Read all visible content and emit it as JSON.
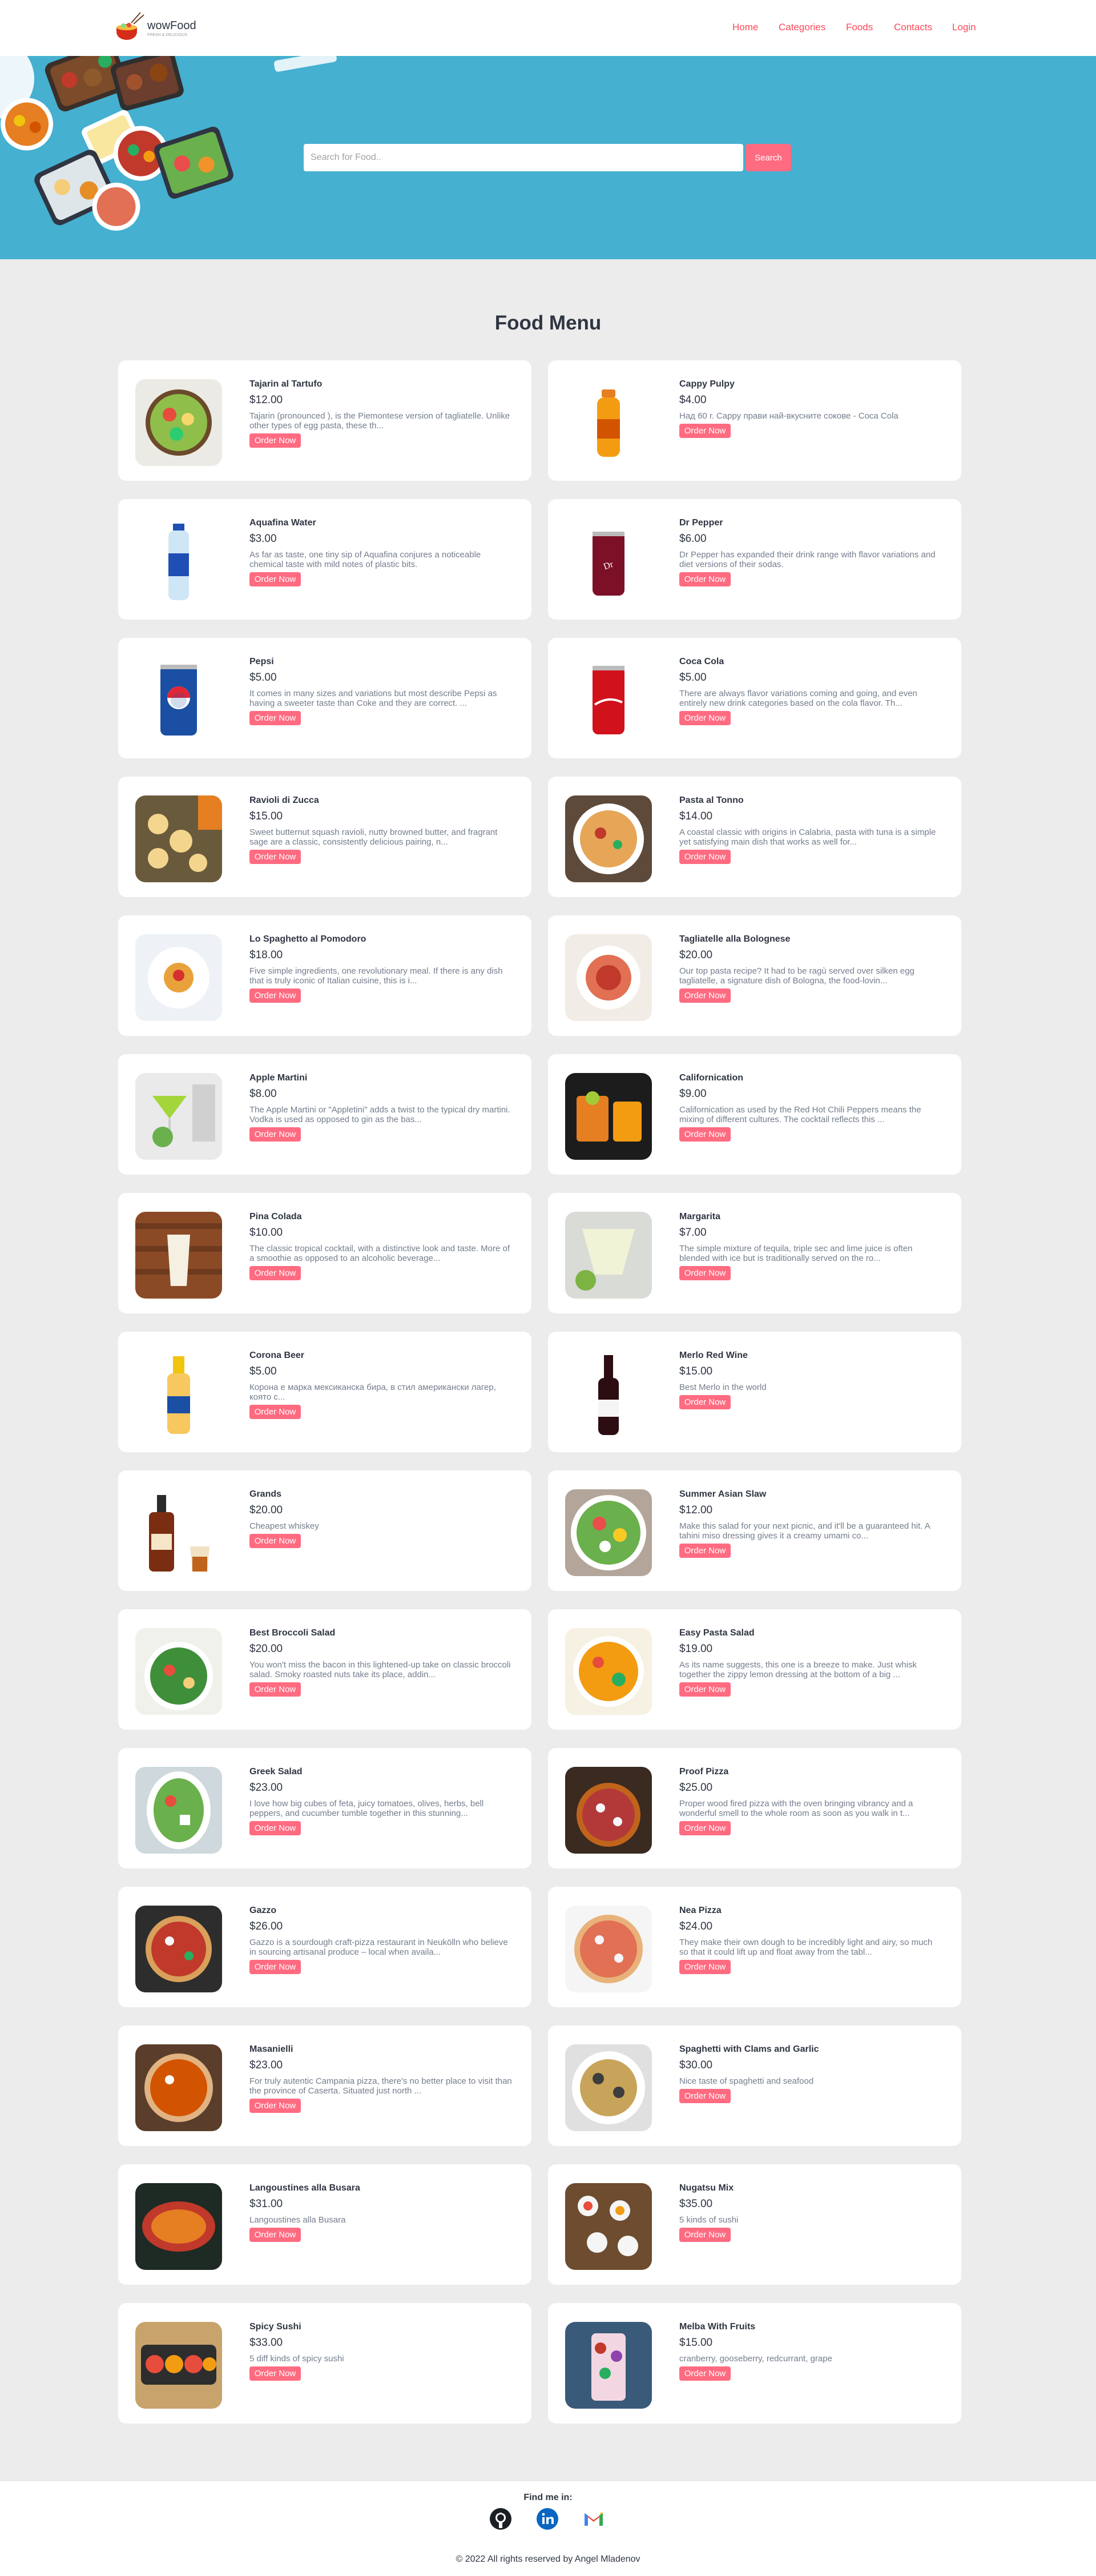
{
  "brand": {
    "name": "wowFood",
    "tagline": "FRESH & DELICIOUS"
  },
  "nav": [
    {
      "label": "Home"
    },
    {
      "label": "Categories"
    },
    {
      "label": "Foods"
    },
    {
      "label": "Contacts"
    },
    {
      "label": "Login"
    }
  ],
  "search": {
    "placeholder": "Search for Food..",
    "button": "Search"
  },
  "menu_title": "Food Menu",
  "order_label": "Order Now",
  "foods": [
    {
      "name": "Tajarin al Tartufo",
      "price": "$12.00",
      "desc": "Tajarin (pronounced ), is the Piemontese version of tagliatelle. Unlike other types of egg pasta, these th...",
      "img": "salad-bowl-image"
    },
    {
      "name": "Cappy Pulpy",
      "price": "$4.00",
      "desc": "Над 60 г. Cappy прави най-вкусните сокове - Coca Cola",
      "img": "orange-juice-bottle-image"
    },
    {
      "name": "Aquafina Water",
      "price": "$3.00",
      "desc": "As far as taste, one tiny sip of Aquafina conjures a noticeable chemical taste with mild notes of plastic bits.",
      "img": "water-bottle-image"
    },
    {
      "name": "Dr Pepper",
      "price": "$6.00",
      "desc": "Dr Pepper has expanded their drink range with flavor variations and diet versions of their sodas.",
      "img": "dr-pepper-can-image"
    },
    {
      "name": "Pepsi",
      "price": "$5.00",
      "desc": "It comes in many sizes and variations but most describe Pepsi as having a sweeter taste than Coke and they are correct. ...",
      "img": "pepsi-can-image"
    },
    {
      "name": "Coca Cola",
      "price": "$5.00",
      "desc": "There are always flavor variations coming and going, and even entirely new drink categories based on the cola flavor. Th...",
      "img": "coca-cola-can-image"
    },
    {
      "name": "Ravioli di Zucca",
      "price": "$15.00",
      "desc": "Sweet butternut squash ravioli, nutty browned butter, and fragrant sage are a classic, consistently delicious pairing, n...",
      "img": "ravioli-image"
    },
    {
      "name": "Pasta al Tonno",
      "price": "$14.00",
      "desc": "A coastal classic with origins in Calabria, pasta with tuna is a simple yet satisfying main dish that works as well for...",
      "img": "pasta-tuna-image"
    },
    {
      "name": "Lo Spaghetto al Pomodoro",
      "price": "$18.00",
      "desc": "Five simple ingredients, one revolutionary meal. If there is any dish that is truly iconic of Italian cuisine, this is i...",
      "img": "spaghetti-pomodoro-image"
    },
    {
      "name": "Tagliatelle alla Bolognese",
      "price": "$20.00",
      "desc": "Our top pasta recipe? It had to be ragù served over silken egg tagliatelle, a signature dish of Bologna, the food-lovin...",
      "img": "tagliatelle-image"
    },
    {
      "name": "Apple Martini",
      "price": "$8.00",
      "desc": "The Apple Martini or \"Appletini\" adds a twist to the typical dry martini. Vodka is used as opposed to gin as the bas...",
      "img": "apple-martini-image"
    },
    {
      "name": "Californication",
      "price": "$9.00",
      "desc": "Californication as used by the Red Hot Chili Peppers means the mixing of different cultures. The cocktail reflects this ...",
      "img": "californication-cocktail-image"
    },
    {
      "name": "Pina Colada",
      "price": "$10.00",
      "desc": "The classic tropical cocktail, with a distinctive look and taste. More of a smoothie as opposed to an alcoholic beverage...",
      "img": "pina-colada-image"
    },
    {
      "name": "Margarita",
      "price": "$7.00",
      "desc": "The simple mixture of tequila, triple sec and lime juice is often blended with ice but is traditionally served on the ro...",
      "img": "margarita-image"
    },
    {
      "name": "Corona Beer",
      "price": "$5.00",
      "desc": "Корона е марка мексиканска бира, в стил американски лагер, която с...",
      "img": "corona-beer-image"
    },
    {
      "name": "Merlo Red Wine",
      "price": "$15.00",
      "desc": "Best Merlo in the world",
      "img": "red-wine-bottle-image"
    },
    {
      "name": "Grands",
      "price": "$20.00",
      "desc": "Cheapest whiskey",
      "img": "whiskey-bottle-image"
    },
    {
      "name": "Summer Asian Slaw",
      "price": "$12.00",
      "desc": "Make this salad for your next picnic, and it'll be a guaranteed hit. A tahini miso dressing gives it a creamy umami co...",
      "img": "asian-slaw-image"
    },
    {
      "name": "Best Broccoli Salad",
      "price": "$20.00",
      "desc": "You won't miss the bacon in this lightened-up take on classic broccoli salad. Smoky roasted nuts take its place, addin...",
      "img": "broccoli-salad-image"
    },
    {
      "name": "Easy Pasta Salad",
      "price": "$19.00",
      "desc": "As its name suggests, this one is a breeze to make. Just whisk together the zippy lemon dressing at the bottom of a big ...",
      "img": "pasta-salad-image"
    },
    {
      "name": "Greek Salad",
      "price": "$23.00",
      "desc": "I love how big cubes of feta, juicy tomatoes, olives, herbs, bell peppers, and cucumber tumble together in this stunning...",
      "img": "greek-salad-image"
    },
    {
      "name": "Proof Pizza",
      "price": "$25.00",
      "desc": "Proper wood fired pizza with the oven bringing vibrancy and a wonderful smell to the whole room as soon as you walk in t...",
      "img": "proof-pizza-image"
    },
    {
      "name": "Gazzo",
      "price": "$26.00",
      "desc": "Gazzo is a sourdough craft-pizza restaurant in Neukölln who believe in sourcing artisanal produce – local when availa...",
      "img": "gazzo-pizza-image"
    },
    {
      "name": "Nea Pizza",
      "price": "$24.00",
      "desc": "They make their own dough to be incredibly light and airy, so much so that it could lift up and float away from the tabl...",
      "img": "nea-pizza-image"
    },
    {
      "name": "Masanielli",
      "price": "$23.00",
      "desc": "For truly autentic Campania pizza, there's no better place to visit than the province of Caserta. Situated just north ...",
      "img": "masanielli-pizza-image"
    },
    {
      "name": "Spaghetti with Clams and Garlic",
      "price": "$30.00",
      "desc": "Nice taste of spaghetti and seafood",
      "img": "spaghetti-clams-image"
    },
    {
      "name": "Langoustines alla Busara",
      "price": "$31.00",
      "desc": "Langoustines alla Busara",
      "img": "langoustines-image"
    },
    {
      "name": "Nugatsu Mix",
      "price": "$35.00",
      "desc": "5 kinds of sushi",
      "img": "sushi-mix-image"
    },
    {
      "name": "Spicy Sushi",
      "price": "$33.00",
      "desc": "5 diff kinds of spicy sushi",
      "img": "spicy-sushi-image"
    },
    {
      "name": "Melba With Fruits",
      "price": "$15.00",
      "desc": "cranberry, gooseberry, redcurrant, grape",
      "img": "melba-fruits-image"
    }
  ],
  "footer": {
    "find_me": "Find me in:",
    "copyright": "© 2022 All rights reserved by Angel Mladenov"
  },
  "colors": {
    "accent": "#ff6b81",
    "nav_link": "#ff4757",
    "hero": "#45b0d0",
    "bg": "#ececec"
  }
}
